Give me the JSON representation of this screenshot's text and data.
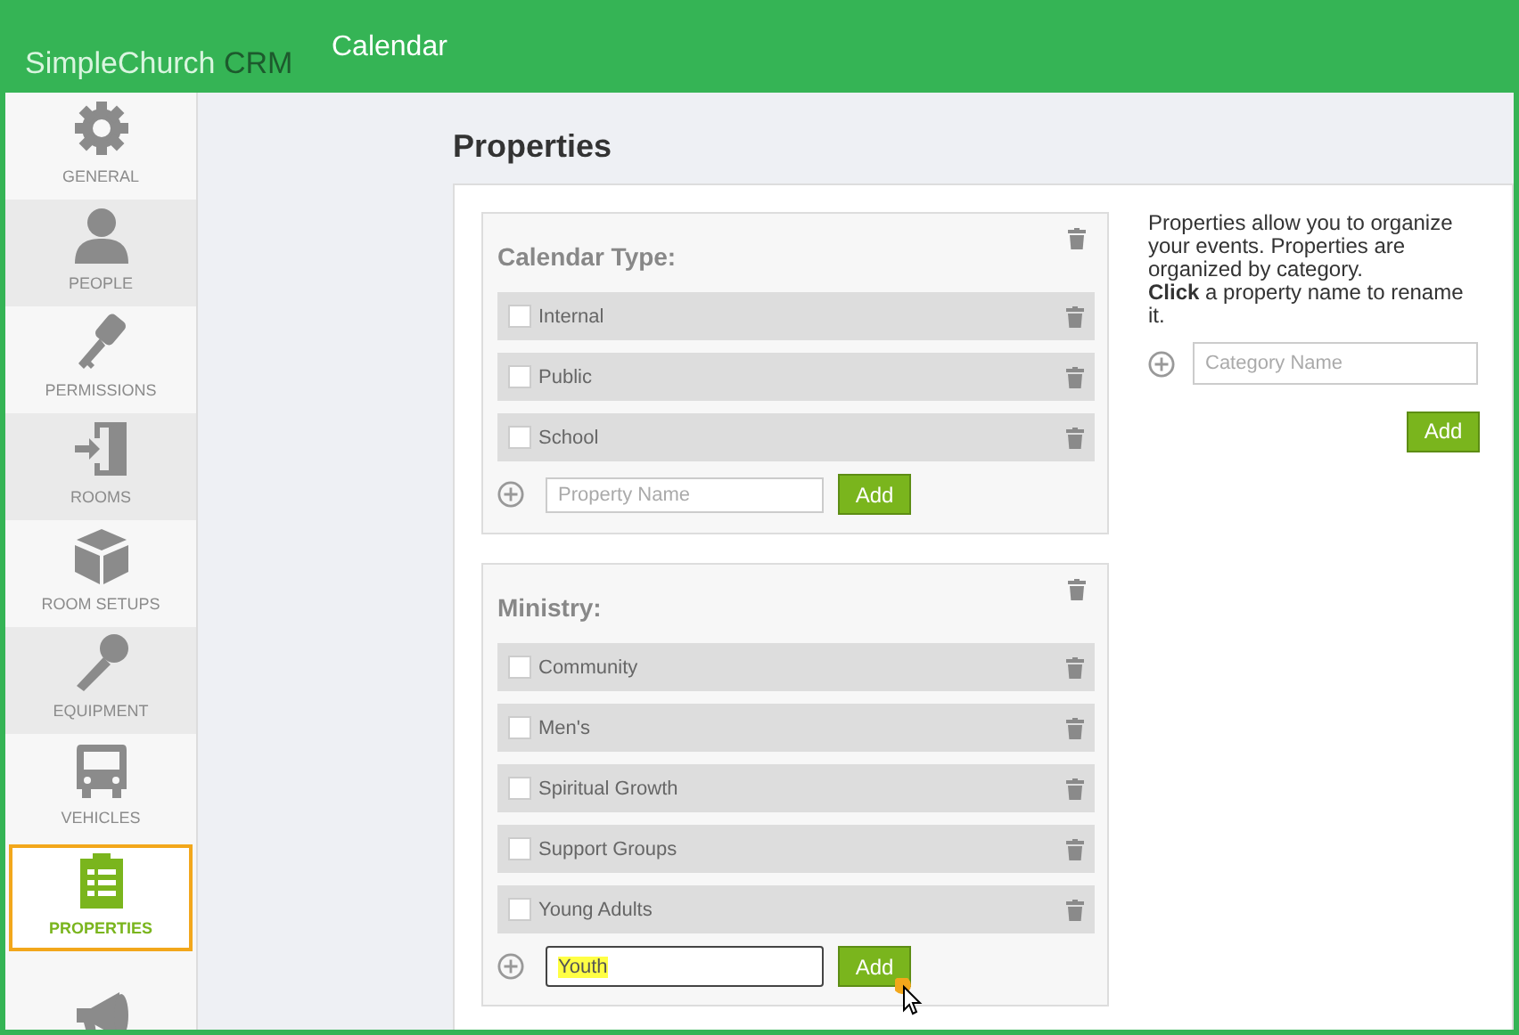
{
  "header": {
    "logo": {
      "name": "SimpleChurch",
      "suffix": "CRM"
    },
    "title": "Calendar"
  },
  "sidebar": {
    "items": [
      {
        "label": "GENERAL",
        "selected": false
      },
      {
        "label": "PEOPLE",
        "selected": false
      },
      {
        "label": "PERMISSIONS",
        "selected": false
      },
      {
        "label": "ROOMS",
        "selected": false
      },
      {
        "label": "ROOM SETUPS",
        "selected": false
      },
      {
        "label": "EQUIPMENT",
        "selected": false
      },
      {
        "label": "VEHICLES",
        "selected": false
      },
      {
        "label": "PROPERTIES",
        "selected": true
      },
      {
        "selected": false
      }
    ]
  },
  "page_title": "Properties",
  "categories": [
    {
      "title": "Calendar Type:",
      "properties": [
        {
          "name": "Internal",
          "checked": false
        },
        {
          "name": "Public",
          "checked": false
        },
        {
          "name": "School",
          "checked": false
        }
      ],
      "new_property": {
        "placeholder": "Property Name",
        "focused": false
      },
      "add_button": "Add"
    },
    {
      "title": "Ministry:",
      "properties": [
        {
          "name": "Community",
          "checked": false
        },
        {
          "name": "Men's",
          "checked": false
        },
        {
          "name": "Spiritual Growth",
          "checked": false
        },
        {
          "name": "Support Groups",
          "checked": false
        },
        {
          "name": "Young Adults",
          "checked": false
        }
      ],
      "new_property": {
        "value": "Youth",
        "focused": true
      },
      "add_button": "Add"
    }
  ],
  "help": [
    "Properties allow you to organize your events. Properties are organized by category.",
    "**Click** a property name to rename it."
  ],
  "new_category": {
    "placeholder": "Category Name"
  },
  "add_button": "Add"
}
